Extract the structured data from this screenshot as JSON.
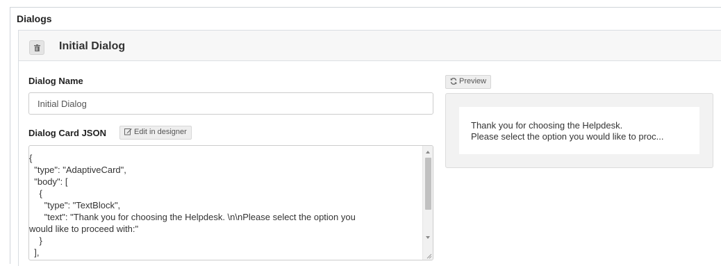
{
  "section": {
    "title": "Dialogs"
  },
  "dialog": {
    "title": "Initial Dialog",
    "name_label": "Dialog Name",
    "name_value": "Initial Dialog",
    "json_label": "Dialog Card JSON",
    "edit_button_label": "Edit in designer",
    "json_lines": [
      "{",
      "  \"type\": \"AdaptiveCard\",",
      "  \"body\": [",
      "    {",
      "      \"type\": \"TextBlock\",",
      "      \"text\": \"Thank you for choosing the Helpdesk. \\n\\nPlease select the option you",
      "would like to proceed with:\"",
      "    }",
      "  ],"
    ]
  },
  "preview": {
    "button_label": "Preview",
    "lines": [
      "Thank you for choosing the Helpdesk.",
      "Please select the option you would like to proc..."
    ]
  },
  "icons": {
    "delete": "trash-icon",
    "edit": "edit-icon",
    "refresh": "refresh-icon"
  }
}
